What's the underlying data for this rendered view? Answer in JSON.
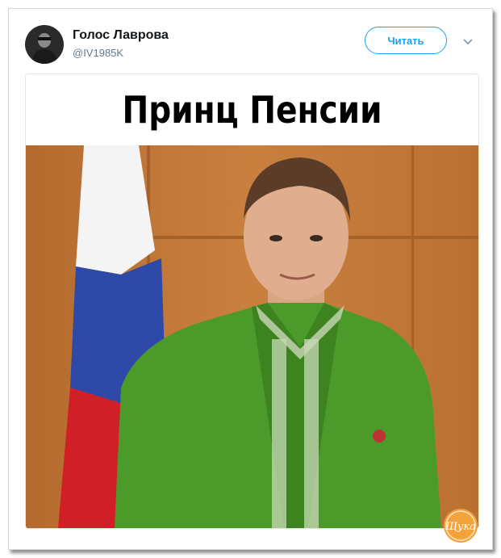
{
  "tweet": {
    "author_name": "Голос Лаврова",
    "author_handle": "@IV1985K",
    "follow_label": "Читать",
    "caption": "Принц Пенсии"
  },
  "watermark_text": "Щука",
  "colors": {
    "accent": "#1da1f2",
    "green_jacket": "#4a9a2a",
    "wall": "#c27a3a"
  },
  "icons": [
    "chevron-down-icon"
  ]
}
